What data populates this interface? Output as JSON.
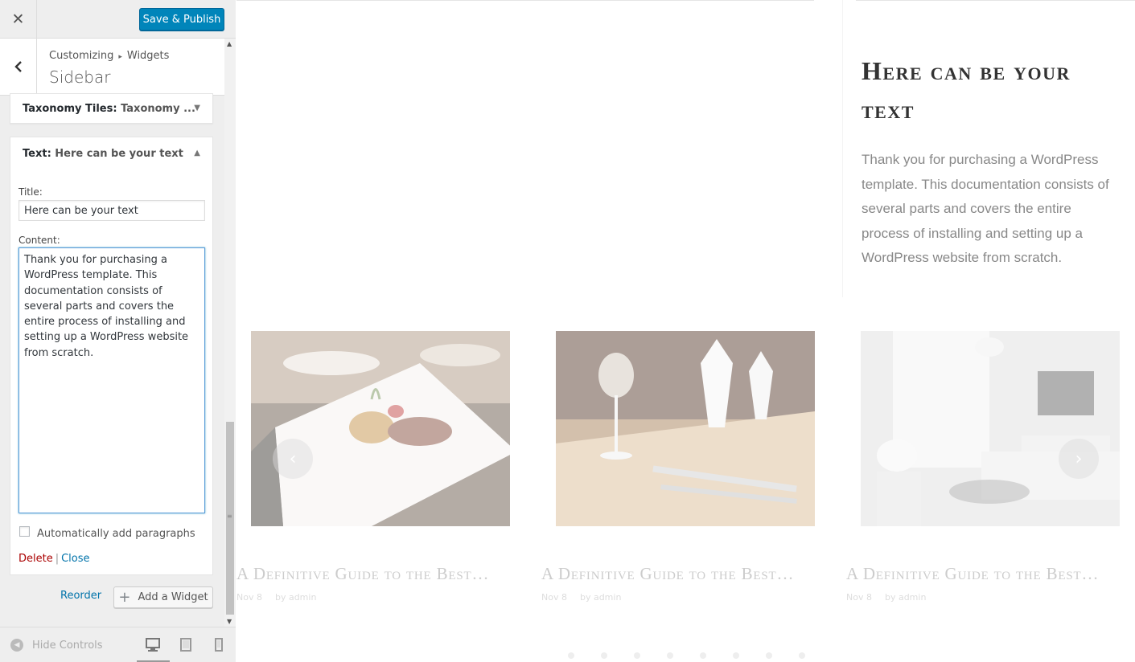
{
  "header": {
    "close_icon": "close-icon",
    "save_label": "Save & Publish"
  },
  "section": {
    "breadcrumb_root": "Customizing",
    "breadcrumb_sep": "▸",
    "breadcrumb_child": "Widgets",
    "title": "Sidebar"
  },
  "widgets": {
    "taxonomy": {
      "type": "Taxonomy Tiles",
      "instance": "Taxonomy ...",
      "expanded": false
    },
    "text": {
      "type": "Text",
      "instance": "Here can be your text",
      "expanded": true,
      "title_label": "Title:",
      "title_value": "Here can be your text",
      "content_label": "Content:",
      "content_value": "Thank you for purchasing a WordPress template. This documentation consists of several parts and covers the entire process of installing and setting up a WordPress website from scratch.",
      "autop_label": "Automatically add paragraphs",
      "autop_checked": false,
      "delete_label": "Delete",
      "separator": "|",
      "close_label": "Close"
    }
  },
  "footer_actions": {
    "reorder_label": "Reorder",
    "add_widget_label": "Add a Widget"
  },
  "footer": {
    "hide_controls_label": "Hide Controls",
    "devices": [
      "desktop",
      "tablet",
      "mobile"
    ],
    "active_device": "desktop"
  },
  "preview": {
    "text_widget_title": "Here can be your text",
    "text_widget_body": "Thank you for purchasing a WordPress template. This documentation consists of several parts and covers the entire process of installing and setting up a WordPress website from scratch.",
    "posts": [
      {
        "title": "A Definitive Guide to the Best…",
        "date": "Nov 8",
        "author": "by admin",
        "image": "plated-dish"
      },
      {
        "title": "A Definitive Guide to the Best…",
        "date": "Nov 8",
        "author": "by admin",
        "image": "table-setting"
      },
      {
        "title": "A Definitive Guide to the Best…",
        "date": "Nov 8",
        "author": "by admin",
        "image": "living-room"
      }
    ],
    "slider_dots": 8
  },
  "colors": {
    "accent": "#0085ba",
    "link": "#0073aa",
    "delete": "#a00000",
    "focus": "#5b9dd9"
  }
}
